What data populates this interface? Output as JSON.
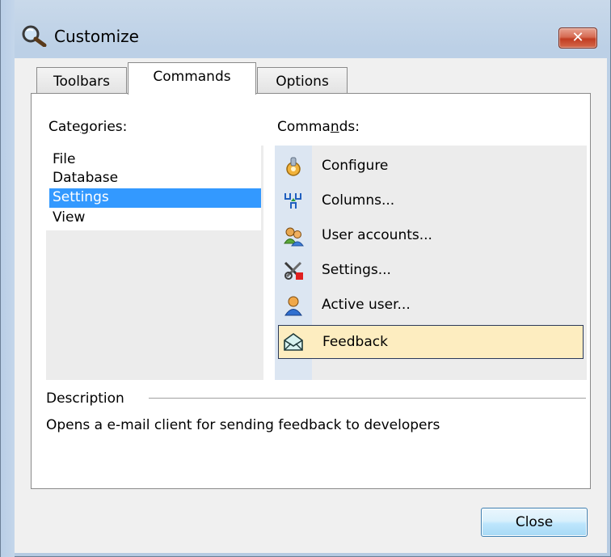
{
  "window": {
    "title": "Customize",
    "close_glyph": "✕"
  },
  "tabs": [
    {
      "label": "Toolbars",
      "active": false
    },
    {
      "label": "Commands",
      "active": true
    },
    {
      "label": "Options",
      "active": false
    }
  ],
  "categories": {
    "label_pre": "Cate",
    "label_u": "g",
    "label_post": "ories:",
    "items": [
      "File",
      "Database",
      "Settings",
      "View"
    ],
    "selected": "Settings"
  },
  "commands": {
    "label_pre": "Comma",
    "label_u": "n",
    "label_post": "ds:",
    "items": [
      {
        "label": "Configure",
        "icon": "configure-icon"
      },
      {
        "label": "Columns...",
        "icon": "columns-icon"
      },
      {
        "label": "User accounts...",
        "icon": "user-accounts-icon"
      },
      {
        "label": "Settings...",
        "icon": "settings-tools-icon"
      },
      {
        "label": "Active user...",
        "icon": "active-user-icon"
      },
      {
        "label": "Feedback",
        "icon": "feedback-envelope-icon"
      }
    ],
    "selected": "Feedback"
  },
  "description": {
    "heading": "Description",
    "text": "Opens a e-mail client for sending feedback to developers"
  },
  "buttons": {
    "close": "Close"
  },
  "colors": {
    "selection_blue": "#3399ff",
    "hover_item": "#fdedc0",
    "title_close_red": "#c13d22"
  }
}
